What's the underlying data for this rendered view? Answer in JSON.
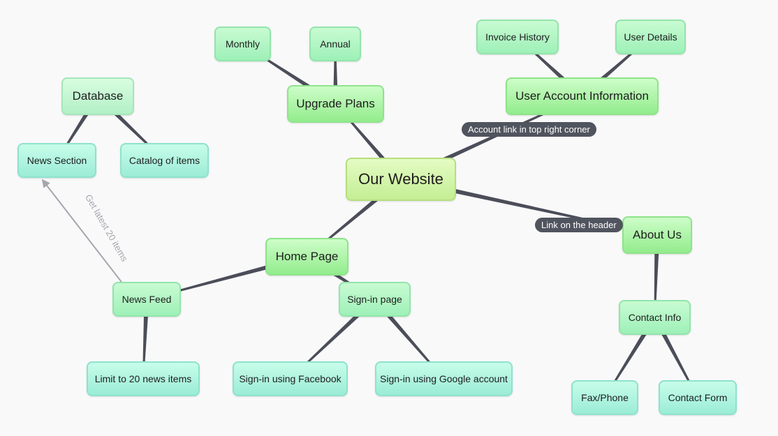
{
  "colors": {
    "background": "#f9f9fa",
    "edge": "#4b4e59",
    "arrow": "#a5a7ad",
    "edge_label_bg": "#50545e"
  },
  "nodes": {
    "our_website": "Our Website",
    "upgrade_plans": "Upgrade Plans",
    "monthly": "Monthly",
    "annual": "Annual",
    "user_account_information": "User Account Information",
    "invoice_history": "Invoice History",
    "user_details": "User Details",
    "about_us": "About Us",
    "contact_info": "Contact Info",
    "fax_phone": "Fax/Phone",
    "contact_form": "Contact Form",
    "home_page": "Home Page",
    "news_feed": "News Feed",
    "limit_news": "Limit to 20 news items",
    "signin_page": "Sign-in page",
    "signin_facebook": "Sign-in using Facebook",
    "signin_google": "Sign-in using Google account",
    "database": "Database",
    "news_section": "News Section",
    "catalog": "Catalog of items"
  },
  "edge_labels": {
    "account_link": "Account link in top right corner",
    "header_link": "Link on the header",
    "latest_items": "Get latest 20 items"
  },
  "edges": [
    {
      "from": "our_website",
      "to": "upgrade_plans"
    },
    {
      "from": "upgrade_plans",
      "to": "monthly"
    },
    {
      "from": "upgrade_plans",
      "to": "annual"
    },
    {
      "from": "our_website",
      "to": "user_account_information",
      "label": "account_link"
    },
    {
      "from": "user_account_information",
      "to": "invoice_history"
    },
    {
      "from": "user_account_information",
      "to": "user_details"
    },
    {
      "from": "our_website",
      "to": "about_us",
      "label": "header_link"
    },
    {
      "from": "about_us",
      "to": "contact_info"
    },
    {
      "from": "contact_info",
      "to": "fax_phone"
    },
    {
      "from": "contact_info",
      "to": "contact_form"
    },
    {
      "from": "our_website",
      "to": "home_page"
    },
    {
      "from": "home_page",
      "to": "news_feed"
    },
    {
      "from": "news_feed",
      "to": "limit_news"
    },
    {
      "from": "home_page",
      "to": "signin_page"
    },
    {
      "from": "signin_page",
      "to": "signin_facebook"
    },
    {
      "from": "signin_page",
      "to": "signin_google"
    },
    {
      "from": "database",
      "to": "news_section"
    },
    {
      "from": "database",
      "to": "catalog"
    },
    {
      "from": "news_feed",
      "to": "news_section",
      "label": "latest_items",
      "arrow": true
    }
  ]
}
